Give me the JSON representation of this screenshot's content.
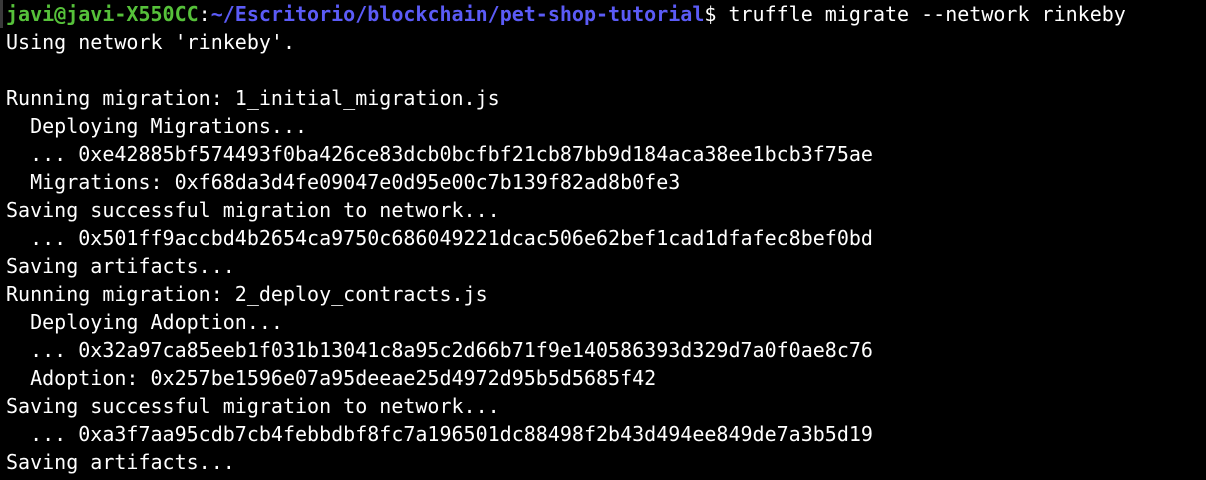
{
  "prompt": {
    "user_host": "javi@javi-X550CC",
    "separator": ":",
    "path": "~/Escritorio/blockchain/pet-shop-tutorial",
    "symbol": "$",
    "command": " truffle migrate --network rinkeby"
  },
  "output_lines": [
    "Using network 'rinkeby'.",
    "",
    "Running migration: 1_initial_migration.js",
    "  Deploying Migrations...",
    "  ... 0xe42885bf574493f0ba426ce83dcb0bcfbf21cb87bb9d184aca38ee1bcb3f75ae",
    "  Migrations: 0xf68da3d4fe09047e0d95e00c7b139f82ad8b0fe3",
    "Saving successful migration to network...",
    "  ... 0x501ff9accbd4b2654ca9750c686049221dcac506e62bef1cad1dfafec8bef0bd",
    "Saving artifacts...",
    "Running migration: 2_deploy_contracts.js",
    "  Deploying Adoption...",
    "  ... 0x32a97ca85eeb1f031b13041c8a95c2d66b71f9e140586393d329d7a0f0ae8c76",
    "  Adoption: 0x257be1596e07a95deeae25d4972d95b5d5685f42",
    "Saving successful migration to network...",
    "  ... 0xa3f7aa95cdb7cb4febbdbf8fc7a196501dc88498f2b43d494ee849de7a3b5d19",
    "Saving artifacts..."
  ],
  "colors": {
    "background": "#000000",
    "text": "#ffffff",
    "user_host": "#56c13a",
    "path": "#5b5bf6"
  }
}
